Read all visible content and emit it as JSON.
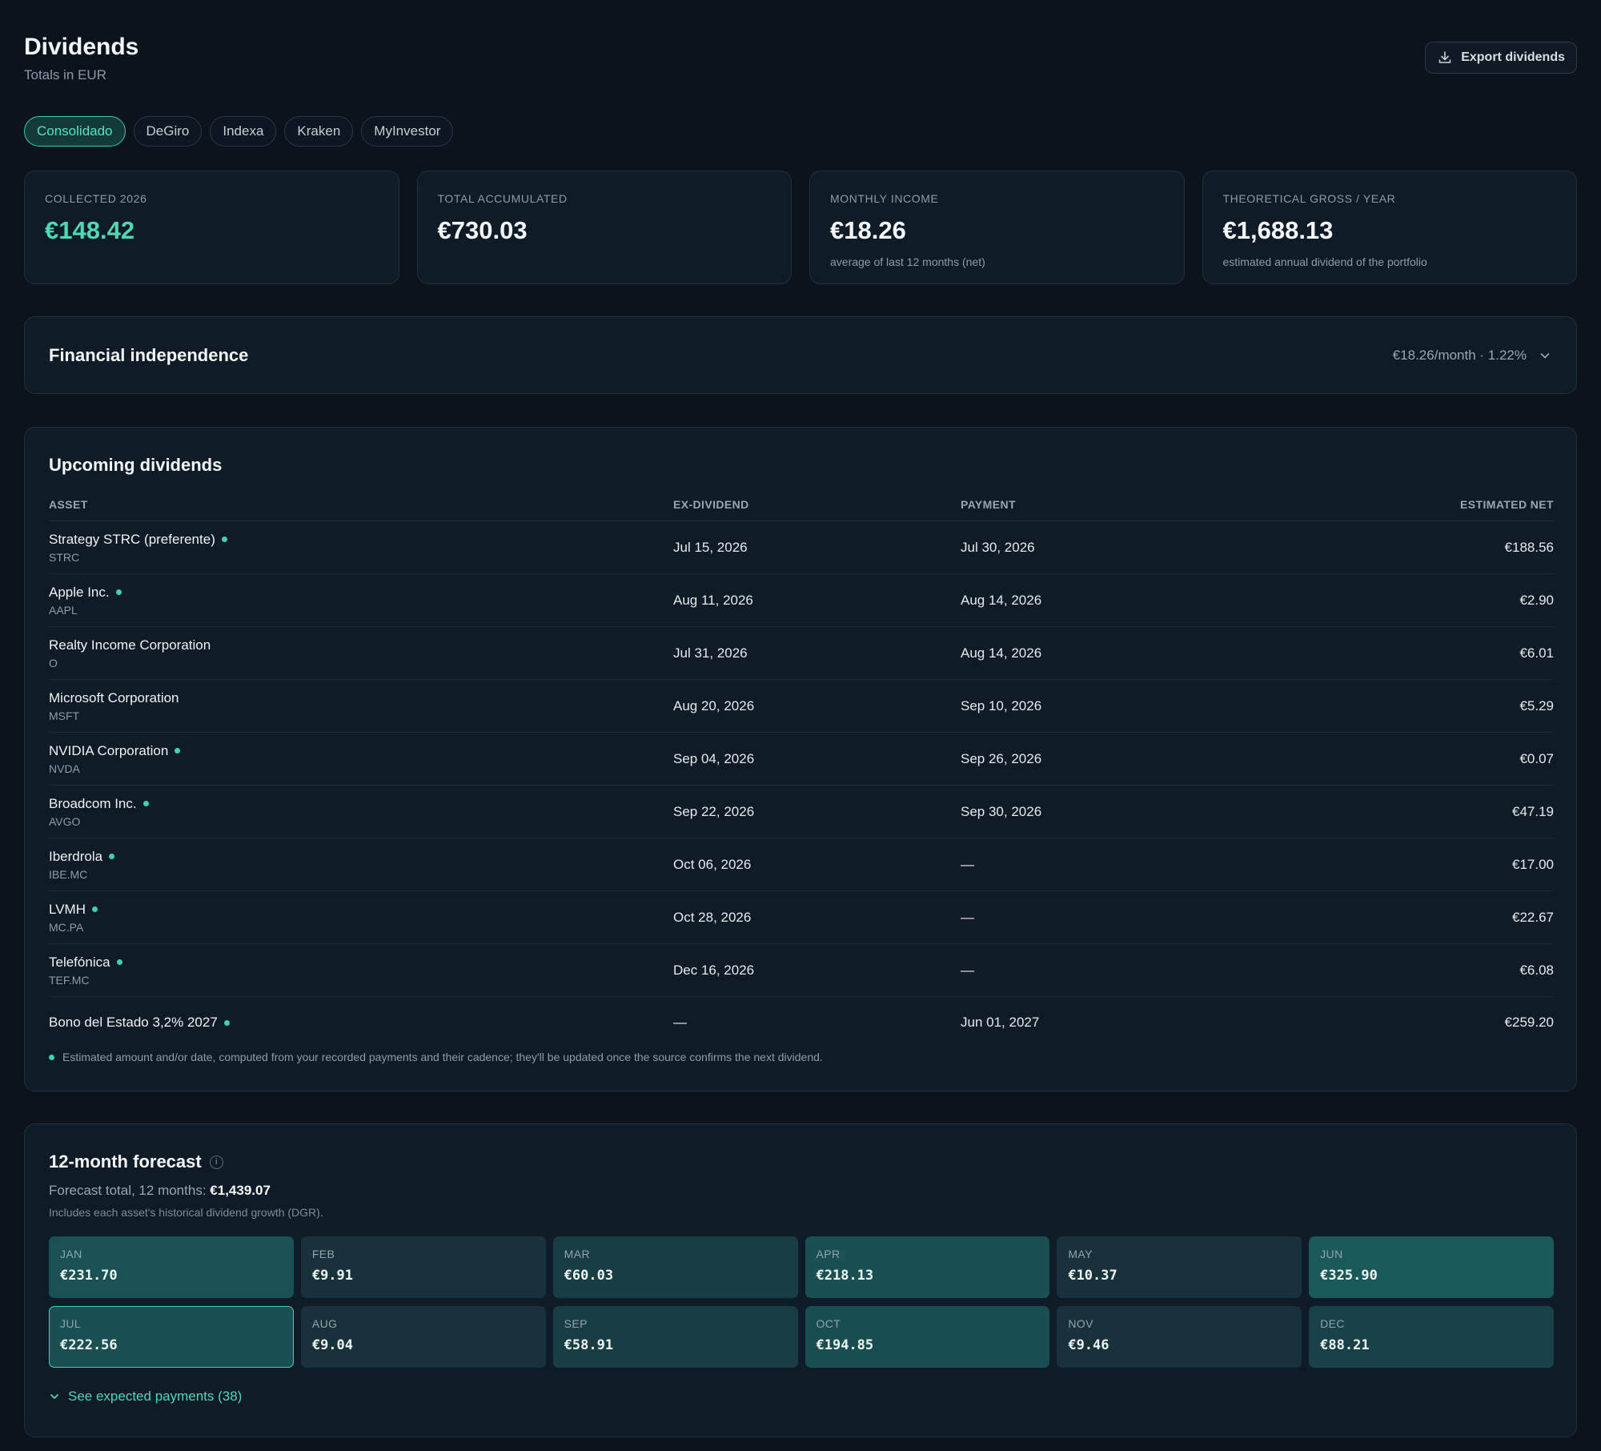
{
  "header": {
    "title": "Dividends",
    "subtitle": "Totals in EUR",
    "export_label": "Export dividends"
  },
  "tabs": [
    {
      "label": "Consolidado",
      "active": true
    },
    {
      "label": "DeGiro",
      "active": false
    },
    {
      "label": "Indexa",
      "active": false
    },
    {
      "label": "Kraken",
      "active": false
    },
    {
      "label": "MyInvestor",
      "active": false
    }
  ],
  "stats": [
    {
      "label": "COLLECTED 2026",
      "value": "€148.42",
      "note": ""
    },
    {
      "label": "TOTAL ACCUMULATED",
      "value": "€730.03",
      "note": ""
    },
    {
      "label": "MONTHLY INCOME",
      "value": "€18.26",
      "note": "average of last 12 months (net)"
    },
    {
      "label": "THEORETICAL GROSS / YEAR",
      "value": "€1,688.13",
      "note": "estimated annual dividend of the portfolio"
    }
  ],
  "financial_independence": {
    "title": "Financial independence",
    "summary": "€18.26/month · 1.22%"
  },
  "upcoming": {
    "title": "Upcoming dividends",
    "columns": {
      "asset": "ASSET",
      "ex": "EX-DIVIDEND",
      "pay": "PAYMENT",
      "net": "ESTIMATED NET"
    },
    "rows": [
      {
        "name": "Strategy STRC (preferente)",
        "ticker": "STRC",
        "ex": "Jul 15, 2026",
        "pay": "Jul 30, 2026",
        "net": "€188.56",
        "estimated": true
      },
      {
        "name": "Apple Inc.",
        "ticker": "AAPL",
        "ex": "Aug 11, 2026",
        "pay": "Aug 14, 2026",
        "net": "€2.90",
        "estimated": true
      },
      {
        "name": "Realty Income Corporation",
        "ticker": "O",
        "ex": "Jul 31, 2026",
        "pay": "Aug 14, 2026",
        "net": "€6.01",
        "estimated": false
      },
      {
        "name": "Microsoft Corporation",
        "ticker": "MSFT",
        "ex": "Aug 20, 2026",
        "pay": "Sep 10, 2026",
        "net": "€5.29",
        "estimated": false
      },
      {
        "name": "NVIDIA Corporation",
        "ticker": "NVDA",
        "ex": "Sep 04, 2026",
        "pay": "Sep 26, 2026",
        "net": "€0.07",
        "estimated": true
      },
      {
        "name": "Broadcom Inc.",
        "ticker": "AVGO",
        "ex": "Sep 22, 2026",
        "pay": "Sep 30, 2026",
        "net": "€47.19",
        "estimated": true
      },
      {
        "name": "Iberdrola",
        "ticker": "IBE.MC",
        "ex": "Oct 06, 2026",
        "pay": "—",
        "net": "€17.00",
        "estimated": true
      },
      {
        "name": "LVMH",
        "ticker": "MC.PA",
        "ex": "Oct 28, 2026",
        "pay": "—",
        "net": "€22.67",
        "estimated": true
      },
      {
        "name": "Telefónica",
        "ticker": "TEF.MC",
        "ex": "Dec 16, 2026",
        "pay": "—",
        "net": "€6.08",
        "estimated": true
      },
      {
        "name": "Bono del Estado 3,2% 2027",
        "ticker": "",
        "ex": "—",
        "pay": "Jun 01, 2027",
        "net": "€259.20",
        "estimated": true
      }
    ],
    "footnote": "Estimated amount and/or date, computed from your recorded payments and their cadence; they'll be updated once the source confirms the next dividend."
  },
  "forecast": {
    "title": "12-month forecast",
    "total_label": "Forecast total, 12 months:",
    "total_value": "€1,439.07",
    "note": "Includes each asset's historical dividend growth (DGR).",
    "months": [
      {
        "label": "JAN",
        "value": "€231.70",
        "amount": 231.7
      },
      {
        "label": "FEB",
        "value": "€9.91",
        "amount": 9.91
      },
      {
        "label": "MAR",
        "value": "€60.03",
        "amount": 60.03
      },
      {
        "label": "APR",
        "value": "€218.13",
        "amount": 218.13
      },
      {
        "label": "MAY",
        "value": "€10.37",
        "amount": 10.37
      },
      {
        "label": "JUN",
        "value": "€325.90",
        "amount": 325.9
      },
      {
        "label": "JUL",
        "value": "€222.56",
        "amount": 222.56,
        "current": true
      },
      {
        "label": "AUG",
        "value": "€9.04",
        "amount": 9.04
      },
      {
        "label": "SEP",
        "value": "€58.91",
        "amount": 58.91
      },
      {
        "label": "OCT",
        "value": "€194.85",
        "amount": 194.85
      },
      {
        "label": "NOV",
        "value": "€9.46",
        "amount": 9.46
      },
      {
        "label": "DEC",
        "value": "€88.21",
        "amount": 88.21
      }
    ],
    "see_payments": "See expected payments (38)"
  },
  "colors": {
    "accent": "#4fd8b3",
    "background": "#0b141d",
    "card": "#0f1b26"
  }
}
